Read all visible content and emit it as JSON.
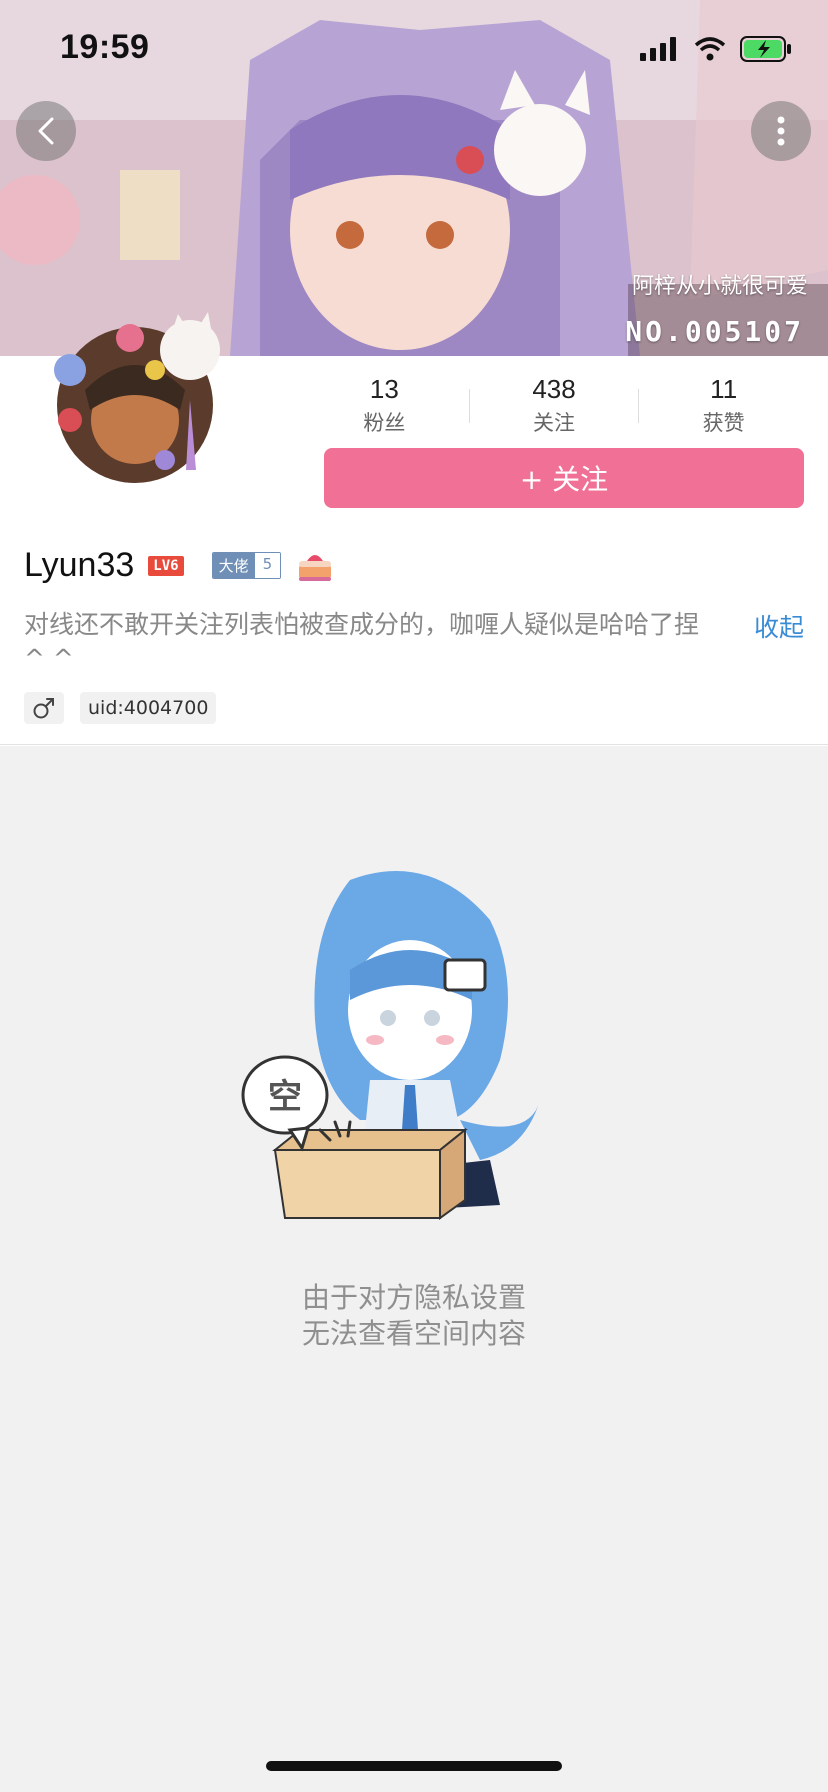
{
  "status_bar": {
    "time": "19:59"
  },
  "banner": {
    "caption": "阿梓从小就很可爱",
    "number": "NO.005107"
  },
  "stats": [
    {
      "value": "13",
      "label": "粉丝"
    },
    {
      "value": "438",
      "label": "关注"
    },
    {
      "value": "11",
      "label": "获赞"
    }
  ],
  "follow_button": "+ 关注",
  "user": {
    "name": "Lyun33",
    "level": "LV6",
    "rank_name": "大佬",
    "rank_level": "5",
    "bio": "对线还不敢开关注列表怕被查成分的，咖喱人疑似是哈哈了捏 ^ ^",
    "collapse": "收起",
    "gender_icon": "male-icon",
    "uid": "uid:4004700"
  },
  "empty": {
    "bubble_text": "空",
    "line1": "由于对方隐私设置",
    "line2": "无法查看空间内容"
  },
  "colors": {
    "accent": "#f07096",
    "link": "#3a8bd6",
    "rank": "#6f8fb7"
  }
}
